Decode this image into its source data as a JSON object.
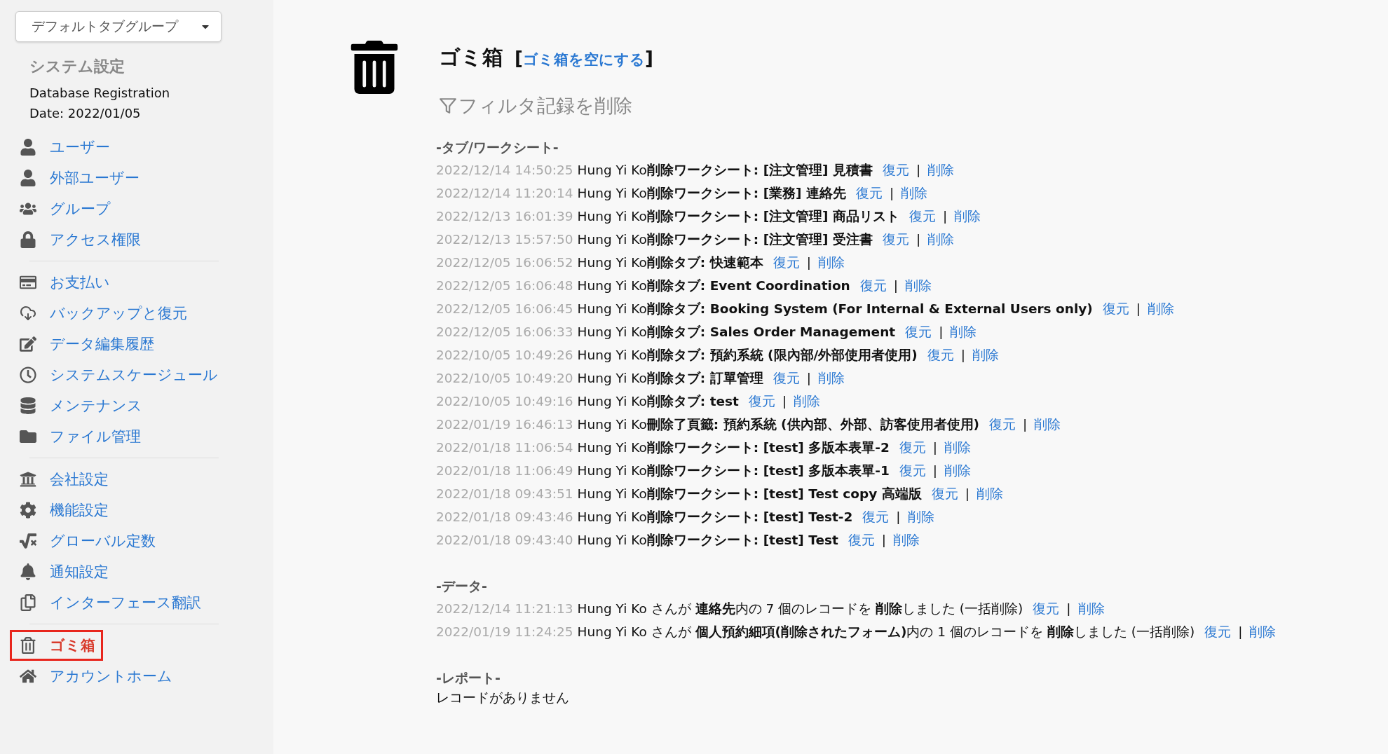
{
  "sidebar": {
    "tab_group_dropdown": "デフォルトタブグループ",
    "title": "システム設定",
    "registration": [
      "Database Registration",
      "Date: 2022/01/05"
    ],
    "groups": [
      [
        {
          "kind": "user",
          "label": "ユーザー",
          "selected": false
        },
        {
          "kind": "user",
          "label": "外部ユーザー",
          "selected": false
        },
        {
          "kind": "users",
          "label": "グループ",
          "selected": false
        },
        {
          "kind": "lock",
          "label": "アクセス権限",
          "selected": false
        }
      ],
      [
        {
          "kind": "card",
          "label": "お支払い",
          "selected": false
        },
        {
          "kind": "cloud",
          "label": "バックアップと復元",
          "selected": false
        },
        {
          "kind": "edit",
          "label": "データ編集履歴",
          "selected": false
        },
        {
          "kind": "clock",
          "label": "システムスケージュール",
          "selected": false
        },
        {
          "kind": "database",
          "label": "メンテナンス",
          "selected": false
        },
        {
          "kind": "folder",
          "label": "ファイル管理",
          "selected": false
        }
      ],
      [
        {
          "kind": "bank",
          "label": "会社設定",
          "selected": false
        },
        {
          "kind": "gear",
          "label": "機能設定",
          "selected": false
        },
        {
          "kind": "sqrt",
          "label": "グローバル定数",
          "selected": false
        },
        {
          "kind": "bell",
          "label": "通知設定",
          "selected": false
        },
        {
          "kind": "copy",
          "label": "インターフェース翻訳",
          "selected": false
        }
      ],
      [
        {
          "kind": "trash",
          "label": "ゴミ箱",
          "selected": true
        },
        {
          "kind": "home",
          "label": "アカウントホーム",
          "selected": false
        }
      ]
    ]
  },
  "main": {
    "title": "ゴミ箱",
    "empty_link": "ゴミ箱を空にする",
    "bracket_open": "[",
    "bracket_close": "]",
    "filter": "フィルタ記録を削除",
    "sections": [
      {
        "heading": "-タブ/ワークシート-",
        "rows": [
          {
            "time": "2022/12/14 14:50:25",
            "text": "Hung Yi Ko**削除ワークシート: [注文管理] 見積書**",
            "restore": "復元",
            "sep": "|",
            "delete": "削除"
          },
          {
            "time": "2022/12/14 11:20:14",
            "text": "Hung Yi Ko**削除ワークシート: [業務] 連絡先**",
            "restore": "復元",
            "sep": "|",
            "delete": "削除"
          },
          {
            "time": "2022/12/13 16:01:39",
            "text": "Hung Yi Ko**削除ワークシート: [注文管理] 商品リスト**",
            "restore": "復元",
            "sep": "|",
            "delete": "削除"
          },
          {
            "time": "2022/12/13 15:57:50",
            "text": "Hung Yi Ko**削除ワークシート: [注文管理] 受注書**",
            "restore": "復元",
            "sep": "|",
            "delete": "削除"
          },
          {
            "time": "2022/12/05 16:06:52",
            "text": "Hung Yi Ko**削除タブ: 快速範本**",
            "restore": "復元",
            "sep": "|",
            "delete": "削除"
          },
          {
            "time": "2022/12/05 16:06:48",
            "text": "Hung Yi Ko**削除タブ: Event Coordination**",
            "restore": "復元",
            "sep": "|",
            "delete": "削除"
          },
          {
            "time": "2022/12/05 16:06:45",
            "text": "Hung Yi Ko**削除タブ: Booking System (For Internal & External Users only)**",
            "restore": "復元",
            "sep": "|",
            "delete": "削除"
          },
          {
            "time": "2022/12/05 16:06:33",
            "text": "Hung Yi Ko**削除タブ: Sales Order Management**",
            "restore": "復元",
            "sep": "|",
            "delete": "削除"
          },
          {
            "time": "2022/10/05 10:49:26",
            "text": "Hung Yi Ko**削除タブ: 預約系統 (限內部/外部使用者使用)**",
            "restore": "復元",
            "sep": "|",
            "delete": "削除"
          },
          {
            "time": "2022/10/05 10:49:20",
            "text": "Hung Yi Ko**削除タブ: 訂單管理**",
            "restore": "復元",
            "sep": "|",
            "delete": "削除"
          },
          {
            "time": "2022/10/05 10:49:16",
            "text": "Hung Yi Ko**削除タブ: test**",
            "restore": "復元",
            "sep": "|",
            "delete": "削除"
          },
          {
            "time": "2022/01/19 16:46:13",
            "text": "Hung Yi Ko**刪除了頁籤: 預約系統 (供內部、外部、訪客使用者使用)**",
            "restore": "復元",
            "sep": "|",
            "delete": "削除"
          },
          {
            "time": "2022/01/18 11:06:54",
            "text": "Hung Yi Ko**削除ワークシート: [test] 多版本表單-2**",
            "restore": "復元",
            "sep": "|",
            "delete": "削除"
          },
          {
            "time": "2022/01/18 11:06:49",
            "text": "Hung Yi Ko**削除ワークシート: [test] 多版本表單-1**",
            "restore": "復元",
            "sep": "|",
            "delete": "削除"
          },
          {
            "time": "2022/01/18 09:43:51",
            "text": "Hung Yi Ko**削除ワークシート: [test] Test copy 高端版**",
            "restore": "復元",
            "sep": "|",
            "delete": "削除"
          },
          {
            "time": "2022/01/18 09:43:46",
            "text": "Hung Yi Ko**削除ワークシート: [test] Test-2**",
            "restore": "復元",
            "sep": "|",
            "delete": "削除"
          },
          {
            "time": "2022/01/18 09:43:40",
            "text": "Hung Yi Ko**削除ワークシート: [test] Test**",
            "restore": "復元",
            "sep": "|",
            "delete": "削除"
          }
        ]
      },
      {
        "heading": "-データ-",
        "rows": [
          {
            "time": "2022/12/14 11:21:13",
            "text": "Hung Yi Ko さんが **連絡先**内の 7 個のレコードを **削除**しました (一括削除)",
            "restore": "復元",
            "sep": "|",
            "delete": "削除"
          },
          {
            "time": "2022/01/19 11:24:25",
            "text": "Hung Yi Ko さんが **個人預約細項(削除されたフォーム)**内の 1 個のレコードを **削除**しました (一括削除)",
            "restore": "復元",
            "sep": "|",
            "delete": "削除"
          }
        ]
      },
      {
        "heading": "-レポート-",
        "empty": "レコードがありません"
      }
    ]
  }
}
